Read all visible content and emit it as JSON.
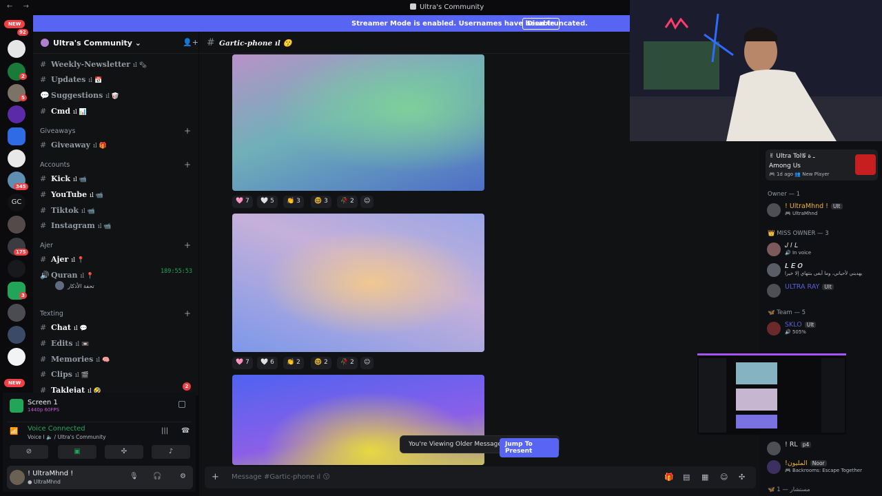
{
  "window": {
    "title": "Ultra's Community",
    "nav": "← →"
  },
  "banner": {
    "text": "Streamer Mode is enabled. Usernames have been truncated.",
    "button": "Disable"
  },
  "servers": {
    "new_label": "NEW",
    "gc_label": "GC",
    "badges": [
      "92",
      "2",
      "5",
      "345",
      "175",
      "3"
    ]
  },
  "server_header": {
    "name": "Ultra's Community"
  },
  "channels": [
    {
      "name": "Weekly-Newsletter",
      "suffix": "ıl 🗞",
      "bright": false
    },
    {
      "name": "Updates",
      "suffix": "ıl 📅",
      "bright": false
    },
    {
      "name": "Suggestions",
      "suffix": "ıl 🥡",
      "bright": false
    },
    {
      "name": "Cmd",
      "suffix": "ıl 📊",
      "bright": true
    },
    {
      "category": "Giveaways"
    },
    {
      "name": "Giveaway",
      "suffix": "ıl 🎁",
      "bright": false
    },
    {
      "category": "Accounts"
    },
    {
      "name": "Kick",
      "suffix": "ıl 📹",
      "bright": true
    },
    {
      "name": "YouTube",
      "suffix": "ıl 📹",
      "bright": true
    },
    {
      "name": "Tiktok",
      "suffix": "ıl 📹",
      "bright": false
    },
    {
      "name": "Instagram",
      "suffix": "ıl 📹",
      "bright": false
    },
    {
      "category": "Ajer"
    },
    {
      "name": "Ajer",
      "suffix": "ıl 📍",
      "bright": true
    },
    {
      "name": "Quran",
      "suffix": "ıl 📍",
      "bright": false
    },
    {
      "category": "Texting"
    },
    {
      "name": "Chat",
      "suffix": "ıl 💬",
      "bright": true
    },
    {
      "name": "Edits",
      "suffix": "ıl 📼",
      "bright": false
    },
    {
      "name": "Memories",
      "suffix": "ıl 🧠",
      "bright": false
    },
    {
      "name": "Clips",
      "suffix": "ıl 🎬",
      "bright": false
    },
    {
      "name": "Taklejat",
      "suffix": "ıl 🤣",
      "bright": true
    }
  ],
  "voice_timer": "189:55:53",
  "voice_user": "تحفة الأذكار",
  "taklejat_badge": "2",
  "screen_share": {
    "title": "Screen 1",
    "sub": "1440p 60FPS"
  },
  "voice": {
    "status": "Voice Connected",
    "channel": "Voice I 🔈 / Ultra's Community"
  },
  "user_panel": {
    "name": "! UltraMhnd !",
    "status": "● UltraMhnd"
  },
  "channel_header": {
    "hash": "#",
    "name": "Gartic-phone ıl 😗"
  },
  "reactions": [
    [
      {
        "e": "🩷",
        "c": "7"
      },
      {
        "e": "🤍",
        "c": "5"
      },
      {
        "e": "👏",
        "c": "3"
      },
      {
        "e": "🤓",
        "c": "3"
      },
      {
        "e": "🥀",
        "c": "2"
      },
      {
        "e": "☺",
        "c": ""
      }
    ],
    [
      {
        "e": "🩷",
        "c": "7"
      },
      {
        "e": "🤍",
        "c": "6"
      },
      {
        "e": "👏",
        "c": "2"
      },
      {
        "e": "🤓",
        "c": "2"
      },
      {
        "e": "🥀",
        "c": "2"
      },
      {
        "e": "☺",
        "c": ""
      }
    ]
  ],
  "older": {
    "text": "You're Viewing Older Messages",
    "button": "Jump To Present"
  },
  "composer": {
    "plus": "+",
    "placeholder": "Message #Gartic-phone ıl 😗"
  },
  "members": {
    "game_card": {
      "name": "✌ Ultra Tol𝒢 ـ ة",
      "game": "Among Us",
      "time": "🎮 1d ago  👥 New Player"
    },
    "owner_header": "Owner — 1",
    "miss_header": "👑 MISS OWNER — 3",
    "team_header": "🦋 Team — 5",
    "misc_header": "🦋 مستشار — 1",
    "list": [
      {
        "name": "! UltraMhnd !",
        "tag": "Ult",
        "status": "🎮 UltraMhnd"
      },
      {
        "name": "𝐽 𝐼 𝐿",
        "tag": "",
        "status": "🔊 In voice"
      },
      {
        "name": "𝑳 𝑬 𝑶",
        "tag": "",
        "status": "يهديني لأحياني، وما أبغى بنتهاي إلا خيرا"
      },
      {
        "name": "ULTRA RAY",
        "tag": "Ult",
        "status": ""
      },
      {
        "name": "SKLO",
        "tag": "Ult",
        "status": "🔊 505%"
      },
      {
        "name": "! RL",
        "tag": "p4",
        "status": ""
      },
      {
        "name": "!المليون",
        "tag": "Noor",
        "status": "🎮 Backrooms: Escape Together"
      }
    ]
  }
}
